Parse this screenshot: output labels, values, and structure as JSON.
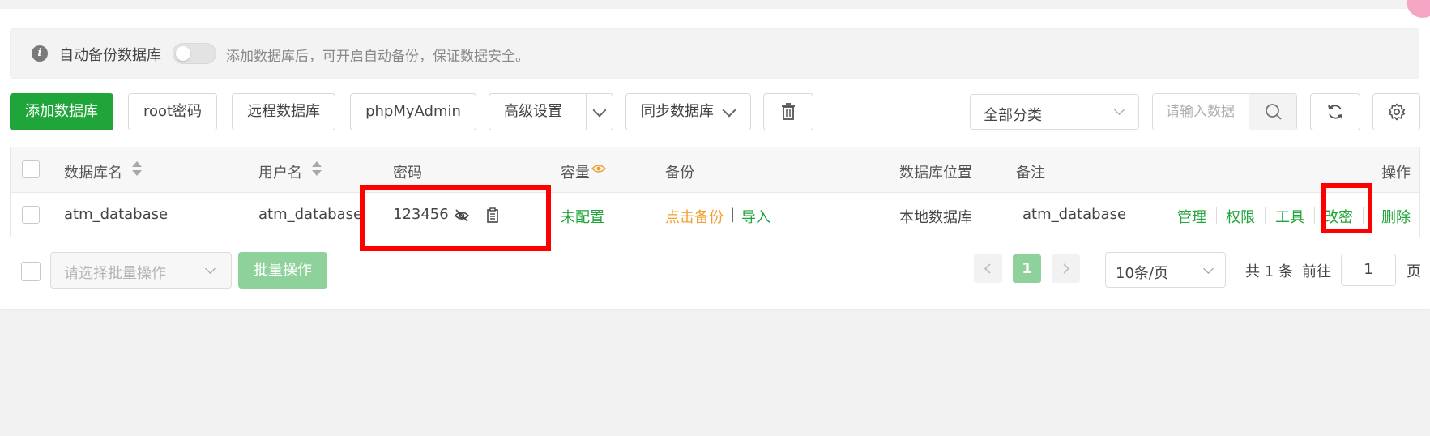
{
  "notice": {
    "label": "自动备份数据库",
    "text": "添加数据库后，可开启自动备份，保证数据安全。",
    "toggle_on": false
  },
  "toolbar": {
    "add_db": "添加数据库",
    "root_password": "root密码",
    "remote_db": "远程数据库",
    "phpmyadmin": "phpMyAdmin",
    "advanced": "高级设置",
    "sync_db": "同步数据库",
    "category": "全部分类",
    "search_placeholder": "请输入数据"
  },
  "table": {
    "headers": {
      "name": "数据库名",
      "user": "用户名",
      "password": "密码",
      "capacity": "容量",
      "backup": "备份",
      "location": "数据库位置",
      "remark": "备注",
      "operations": "操作"
    },
    "rows": [
      {
        "name": "atm_database",
        "user": "atm_database",
        "password": "123456",
        "capacity": "未配置",
        "backup_action": "点击备份",
        "backup_sep": "|",
        "import": "导入",
        "location": "本地数据库",
        "remark": "atm_database",
        "ops": [
          "管理",
          "权限",
          "工具",
          "改密",
          "删除"
        ]
      }
    ]
  },
  "footer": {
    "batch_placeholder": "请选择批量操作",
    "batch_button": "批量操作",
    "current_page": "1",
    "page_size": "10条/页",
    "total": "共 1 条",
    "goto_label": "前往",
    "goto_value": "1",
    "page_suffix": "页"
  },
  "colors": {
    "accent": "#20a53a",
    "orange": "#f0a030",
    "highlight": "#ff0000"
  }
}
